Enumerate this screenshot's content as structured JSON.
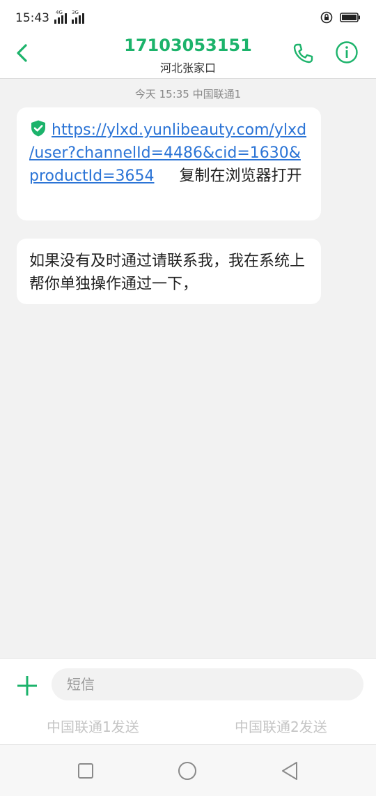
{
  "status": {
    "time": "15:43",
    "signal1_tag": "4G",
    "signal2_tag": "3G",
    "icons": [
      "signal-icon",
      "signal-icon",
      "rotation-lock-icon",
      "battery-icon"
    ]
  },
  "header": {
    "title": "17103053151",
    "subtitle": "河北张家口"
  },
  "thread": {
    "timestamp": "今天 15:35  中国联通1",
    "messages": [
      {
        "link_lines": [
          "https://ylxd.yunlibeauty.com/ylxd",
          "/user?channelId=4486&cid=1630&",
          "productId=3654"
        ],
        "trailing_text": "复制在浏览器打开"
      },
      {
        "text": "如果没有及时通过请联系我，我在系统上帮你单独操作通过一下，"
      }
    ]
  },
  "composer": {
    "placeholder": "短信",
    "send1": "中国联通1发送",
    "send2": "中国联通2发送"
  },
  "colors": {
    "accent": "#1cb36b",
    "link": "#2b74d6"
  }
}
